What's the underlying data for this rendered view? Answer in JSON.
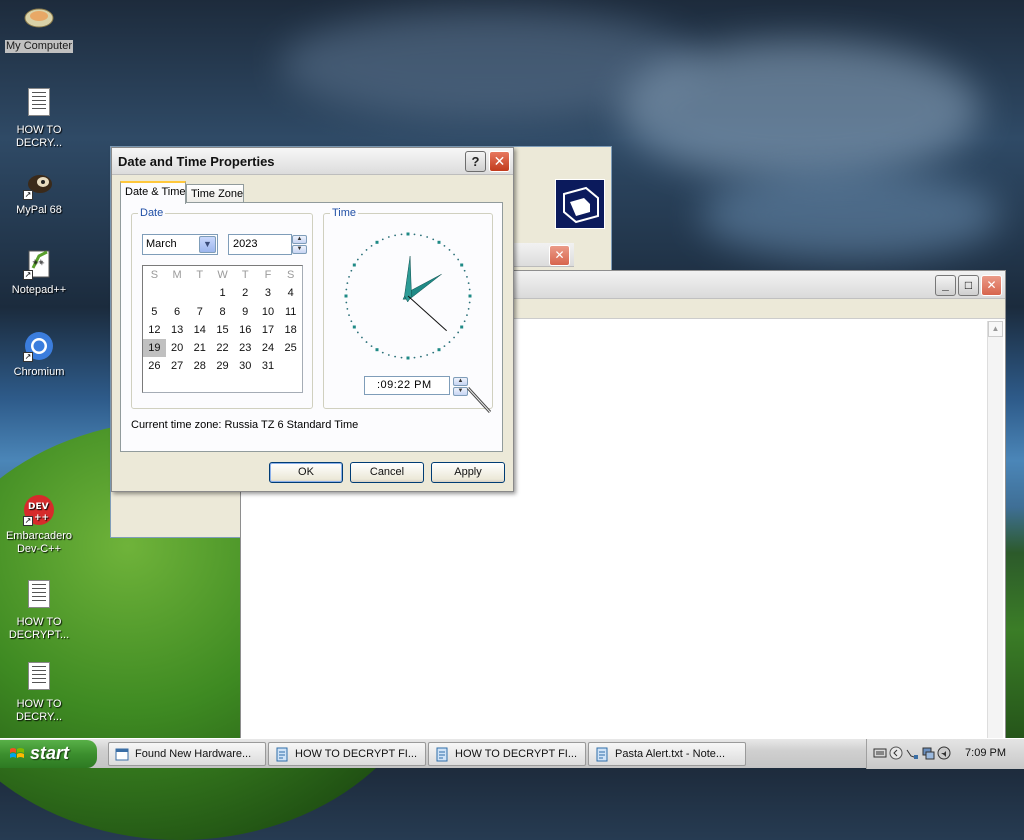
{
  "desktop": {
    "icons": [
      {
        "label": "My Computer"
      },
      {
        "label": "HOW TO DECRY..."
      },
      {
        "label": "MyPal 68"
      },
      {
        "label": "Notepad++"
      },
      {
        "label": "Chromium"
      },
      {
        "label": "Embarcadero Dev-C++"
      },
      {
        "label": "HOW TO DECRYPT..."
      },
      {
        "label": "HOW TO DECRY..."
      }
    ]
  },
  "dialog": {
    "title": "Date and Time Properties",
    "help_label": "?",
    "close_label": "✕",
    "tabs": [
      {
        "label": "Date & Time"
      },
      {
        "label": "Time Zone"
      }
    ],
    "date_group_label": "Date",
    "time_group_label": "Time",
    "month": "March",
    "year": "2023",
    "weekday_headers": [
      "S",
      "M",
      "T",
      "W",
      "T",
      "F",
      "S"
    ],
    "weeks": [
      [
        "",
        "",
        "",
        "1",
        "2",
        "3",
        "4"
      ],
      [
        "5",
        "6",
        "7",
        "8",
        "9",
        "10",
        "11"
      ],
      [
        "12",
        "13",
        "14",
        "15",
        "16",
        "17",
        "18"
      ],
      [
        "19",
        "20",
        "21",
        "22",
        "23",
        "24",
        "25"
      ],
      [
        "26",
        "27",
        "28",
        "29",
        "30",
        "31",
        ""
      ]
    ],
    "selected_day": "19",
    "time_value": ":09:22 PM",
    "time_zone_text": "Current time zone:  Russia TZ 6 Standard Time",
    "buttons": {
      "ok": "OK",
      "cancel": "Cancel",
      "apply": "Apply"
    }
  },
  "taskbar": {
    "start_label": "start",
    "items": [
      {
        "label": "Found New Hardware..."
      },
      {
        "label": "HOW TO DECRYPT FI..."
      },
      {
        "label": "HOW TO DECRYPT FI..."
      },
      {
        "label": "Pasta Alert.txt - Note..."
      }
    ],
    "clock": "7:09 PM"
  },
  "colors": {
    "accent": "#2150a6",
    "close_red": "#c13b1d",
    "start_green": "#3c8f2e",
    "clock_teal": "#1f8a86"
  }
}
